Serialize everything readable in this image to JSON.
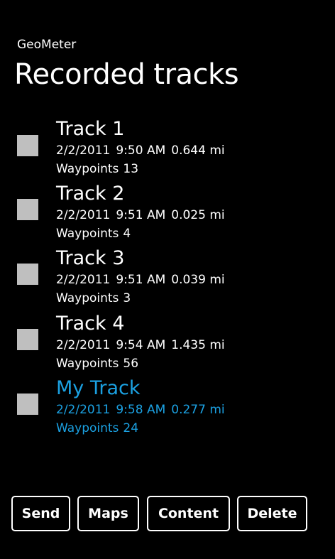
{
  "app": {
    "title": "GeoMeter"
  },
  "page": {
    "title": "Recorded tracks"
  },
  "colors": {
    "background": "#000000",
    "text": "#ffffff",
    "accent": "#1ba1e2",
    "checkbox": "#bfbfbf"
  },
  "tracks": [
    {
      "name": "Track 1",
      "date": "2/2/2011",
      "time": "9:50 AM",
      "distance": "0.644 mi",
      "waypoints_label": "Waypoints",
      "waypoints": "13",
      "selected": false
    },
    {
      "name": "Track 2",
      "date": "2/2/2011",
      "time": "9:51 AM",
      "distance": "0.025 mi",
      "waypoints_label": "Waypoints",
      "waypoints": "4",
      "selected": false
    },
    {
      "name": "Track 3",
      "date": "2/2/2011",
      "time": "9:51 AM",
      "distance": "0.039 mi",
      "waypoints_label": "Waypoints",
      "waypoints": "3",
      "selected": false
    },
    {
      "name": "Track 4",
      "date": "2/2/2011",
      "time": "9:54 AM",
      "distance": "1.435 mi",
      "waypoints_label": "Waypoints",
      "waypoints": "56",
      "selected": false
    },
    {
      "name": "My Track",
      "date": "2/2/2011",
      "time": "9:58 AM",
      "distance": "0.277 mi",
      "waypoints_label": "Waypoints",
      "waypoints": "24",
      "selected": true
    }
  ],
  "buttons": {
    "send": "Send",
    "maps": "Maps",
    "content": "Content",
    "delete": "Delete"
  }
}
